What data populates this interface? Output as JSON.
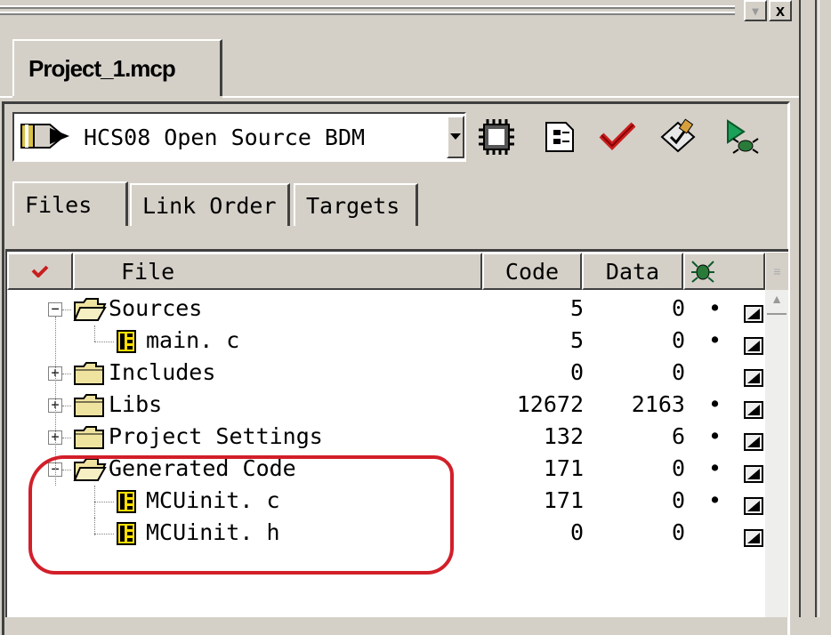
{
  "project": {
    "tab_label": "Project_1.mcp"
  },
  "window": {
    "minimize_glyph": "▾",
    "close_glyph": "x"
  },
  "target": {
    "selected": "HCS08 Open Source BDM"
  },
  "toolbar": {
    "icons": [
      "chip-icon",
      "settings-icon",
      "check-icon",
      "make-icon",
      "debug-icon"
    ]
  },
  "tabs": [
    "Files",
    "Link Order",
    "Targets"
  ],
  "columns": {
    "file": "File",
    "code": "Code",
    "data": "Data"
  },
  "rows": [
    {
      "name": "Sources",
      "code": "5",
      "data": "0",
      "dot": "•",
      "level": 0,
      "type": "folder-open",
      "expander": "−"
    },
    {
      "name": "main. c",
      "code": "5",
      "data": "0",
      "dot": "•",
      "level": 1,
      "type": "file",
      "expander": ""
    },
    {
      "name": "Includes",
      "code": "0",
      "data": "0",
      "dot": "",
      "level": 0,
      "type": "folder",
      "expander": "+"
    },
    {
      "name": "Libs",
      "code": "12672",
      "data": "2163",
      "dot": "•",
      "level": 0,
      "type": "folder",
      "expander": "+"
    },
    {
      "name": "Project Settings",
      "code": "132",
      "data": "6",
      "dot": "•",
      "level": 0,
      "type": "folder",
      "expander": "+"
    },
    {
      "name": "Generated Code",
      "code": "171",
      "data": "0",
      "dot": "•",
      "level": 0,
      "type": "folder-open",
      "expander": "−"
    },
    {
      "name": "MCUinit. c",
      "code": "171",
      "data": "0",
      "dot": "•",
      "level": 1,
      "type": "file",
      "expander": ""
    },
    {
      "name": "MCUinit. h",
      "code": "0",
      "data": "0",
      "dot": "",
      "level": 1,
      "type": "file",
      "expander": ""
    }
  ],
  "colors": {
    "annotation": "#d21f2a",
    "window_bg": "#d4d0c8"
  }
}
